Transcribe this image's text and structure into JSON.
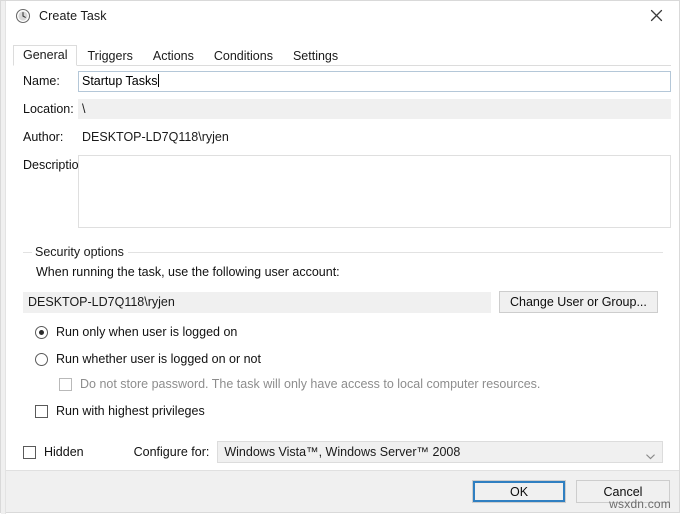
{
  "window": {
    "title": "Create Task",
    "icon": "clock-icon",
    "close_label": "×"
  },
  "tabs": [
    {
      "label": "General",
      "active": true
    },
    {
      "label": "Triggers",
      "active": false
    },
    {
      "label": "Actions",
      "active": false
    },
    {
      "label": "Conditions",
      "active": false
    },
    {
      "label": "Settings",
      "active": false
    }
  ],
  "general": {
    "name_label": "Name:",
    "name_value": "Startup Tasks",
    "location_label": "Location:",
    "location_value": "\\",
    "author_label": "Author:",
    "author_value": "DESKTOP-LD7Q118\\ryjen",
    "description_label": "Description:",
    "description_value": ""
  },
  "security": {
    "legend": "Security options",
    "prompt": "When running the task, use the following user account:",
    "account_value": "DESKTOP-LD7Q118\\ryjen",
    "change_button": "Change User or Group...",
    "run_logged_on_label": "Run only when user is logged on",
    "run_logged_on_checked": true,
    "run_whether_label": "Run whether user is logged on or not",
    "run_whether_checked": false,
    "no_password_label": "Do not store password.  The task will only have access to local computer resources.",
    "no_password_checked": false,
    "no_password_disabled": true,
    "highest_privileges_label": "Run with highest privileges",
    "highest_privileges_checked": false
  },
  "bottom": {
    "hidden_label": "Hidden",
    "hidden_checked": false,
    "configure_label": "Configure for:",
    "configure_value": "Windows Vista™, Windows Server™ 2008"
  },
  "footer": {
    "ok_label": "OK",
    "cancel_label": "Cancel",
    "watermark": "wsxdn.com"
  },
  "colors": {
    "focus_blue": "#2f7fc1",
    "field_border": "#b4c7d8",
    "readonly_bg": "#f0f0f0"
  }
}
